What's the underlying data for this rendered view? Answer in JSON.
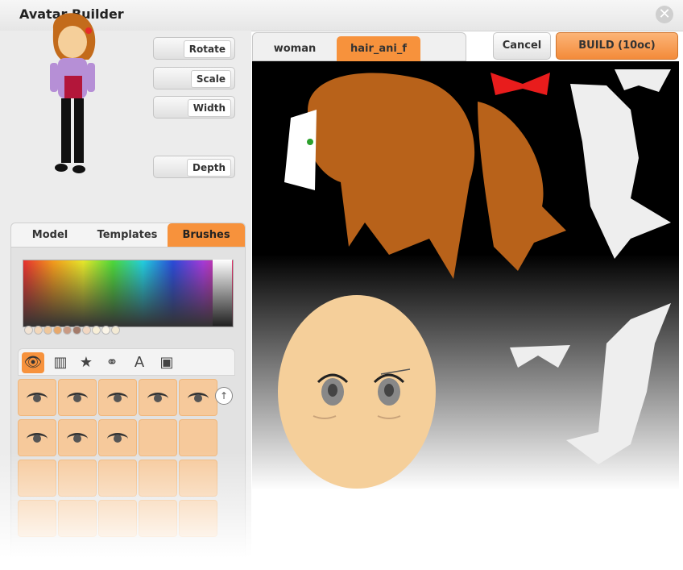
{
  "window": {
    "title": "Avatar Builder"
  },
  "transform_buttons": {
    "rotate": "Rotate",
    "scale": "Scale",
    "width": "Width",
    "depth": "Depth"
  },
  "tabs": {
    "model": "Model",
    "templates": "Templates",
    "brushes": "Brushes"
  },
  "palette": {
    "swatches": [
      "#f1e3d4",
      "#f3d7b9",
      "#efc79b",
      "#e7a86b",
      "#c99a83",
      "#a47b6a",
      "#f2d7c2",
      "#f8efd7",
      "#fbf5e8",
      "#f3ead4"
    ]
  },
  "canvas_tabs": {
    "tab1": "woman",
    "tab2": "hair_ani_f"
  },
  "actions": {
    "cancel": "Cancel",
    "build": "BUILD (10oc)"
  },
  "colors": {
    "accent": "#f7923c",
    "hair": "#b8621a",
    "bow": "#e81c1c",
    "skin": "#f5cf9a"
  },
  "icons": [
    "eye-icon",
    "texture-icon",
    "star-icon",
    "link-icon",
    "text-icon",
    "image-icon"
  ]
}
